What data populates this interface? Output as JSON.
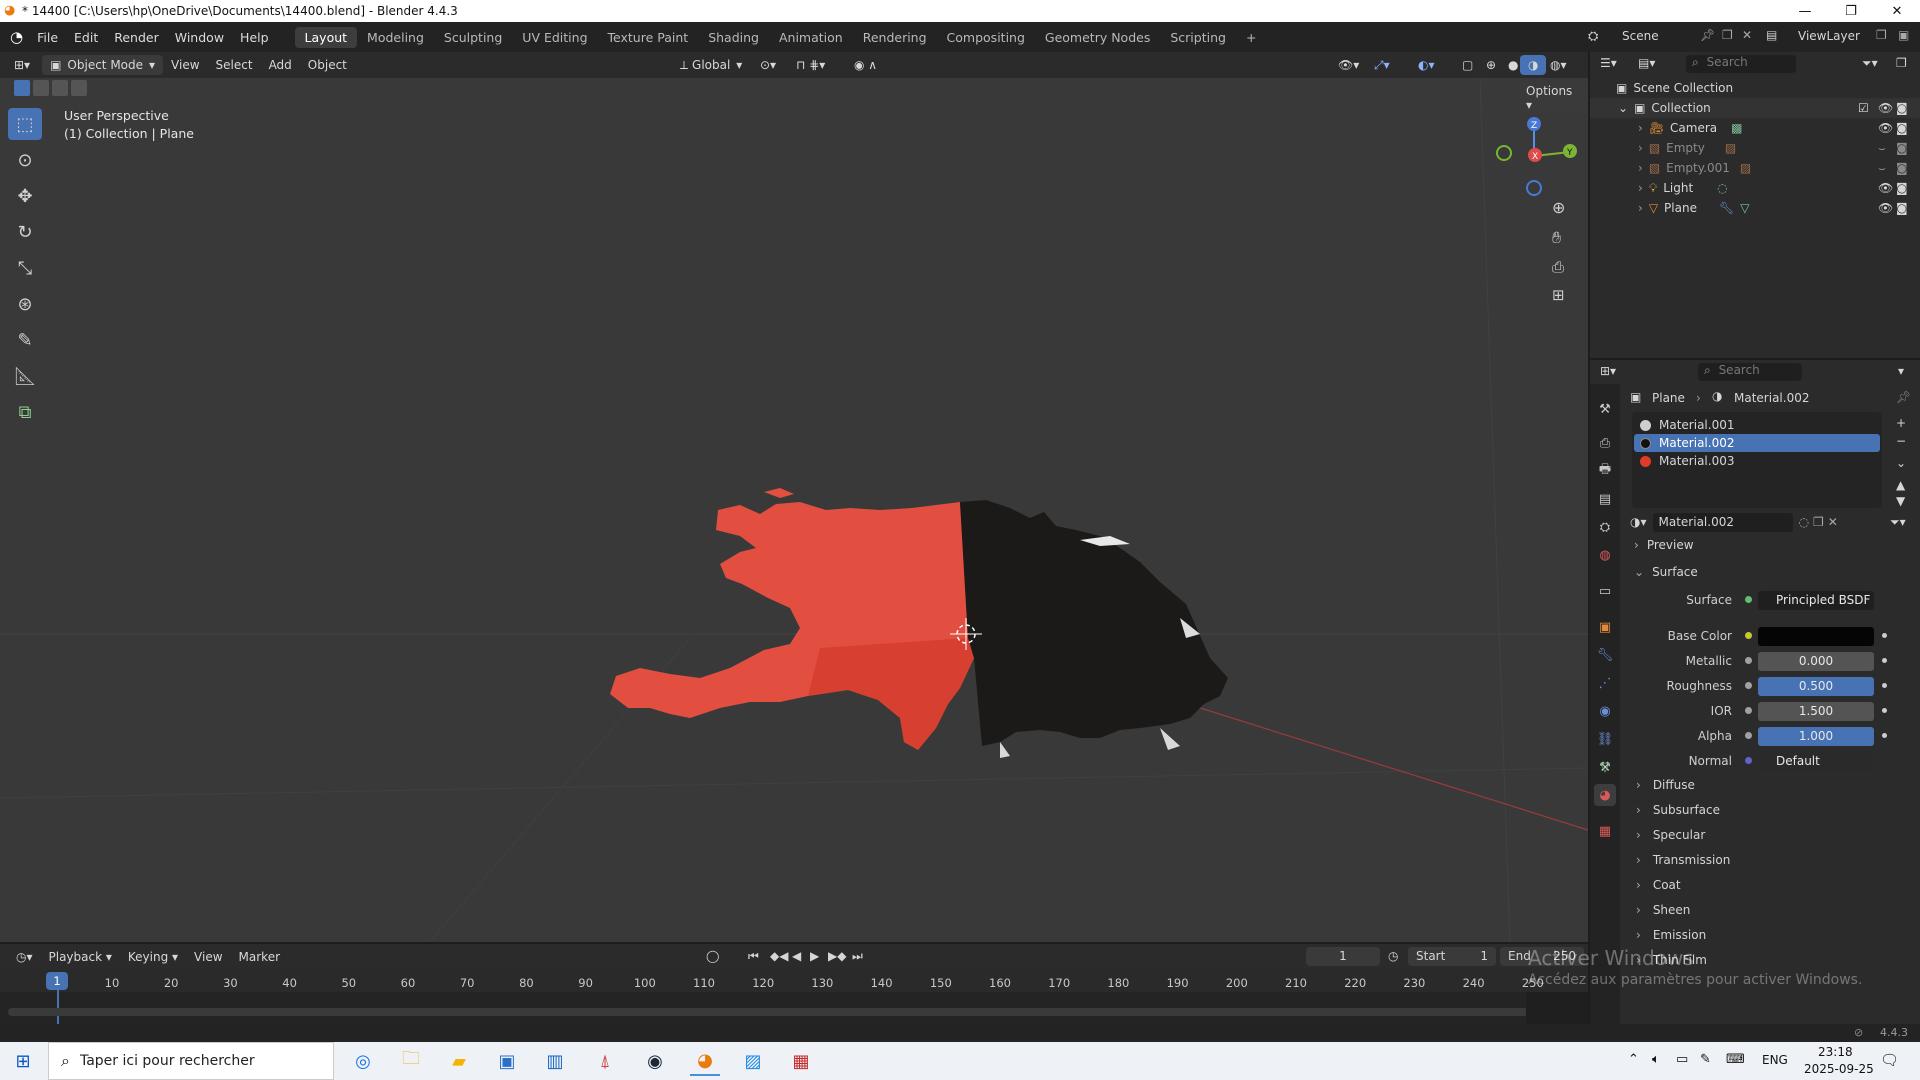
{
  "window": {
    "title": "* 14400 [C:\\Users\\hp\\OneDrive\\Documents\\14400.blend] - Blender 4.4.3",
    "minimize": "—",
    "maximize": "❐",
    "close": "✕"
  },
  "menu": [
    "File",
    "Edit",
    "Render",
    "Window",
    "Help"
  ],
  "workspaces": [
    "Layout",
    "Modeling",
    "Sculpting",
    "UV Editing",
    "Texture Paint",
    "Shading",
    "Animation",
    "Rendering",
    "Compositing",
    "Geometry Nodes",
    "Scripting"
  ],
  "scene": {
    "label": "Scene",
    "view_layer": "ViewLayer"
  },
  "viewport_header": {
    "mode": "Object Mode",
    "menus": [
      "View",
      "Select",
      "Add",
      "Object"
    ],
    "orientation": "Global",
    "options": "Options"
  },
  "viewport": {
    "perspective": "User Perspective",
    "collection_info": "(1) Collection | Plane",
    "gizmo": {
      "z": "Z",
      "x": "X",
      "y": "Y"
    }
  },
  "outliner": {
    "search_placeholder": "Search",
    "scene_collection": "Scene Collection",
    "collection": "Collection",
    "items": [
      {
        "name": "Camera"
      },
      {
        "name": "Empty"
      },
      {
        "name": "Empty.001"
      },
      {
        "name": "Light"
      },
      {
        "name": "Plane"
      }
    ]
  },
  "properties": {
    "search_placeholder": "Search",
    "breadcrumb_object": "Plane",
    "breadcrumb_material": "Material.002",
    "slots": [
      {
        "name": "Material.001",
        "color": "#cfcfcf"
      },
      {
        "name": "Material.002",
        "color": "#111111"
      },
      {
        "name": "Material.003",
        "color": "#e03a2a"
      }
    ],
    "material_name": "Material.002",
    "panels": {
      "preview": "Preview",
      "surface": "Surface"
    },
    "surface": {
      "surface_label": "Surface",
      "surface_value": "Principled BSDF",
      "base_color_label": "Base Color",
      "metallic_label": "Metallic",
      "metallic": "0.000",
      "roughness_label": "Roughness",
      "roughness": "0.500",
      "ior_label": "IOR",
      "ior": "1.500",
      "alpha_label": "Alpha",
      "alpha": "1.000",
      "normal_label": "Normal",
      "normal": "Default"
    },
    "subpanels": [
      "Diffuse",
      "Subsurface",
      "Specular",
      "Transmission",
      "Coat",
      "Sheen",
      "Emission",
      "Thin Film"
    ]
  },
  "timeline": {
    "menus": [
      "Playback",
      "Keying",
      "View",
      "Marker"
    ],
    "current_frame": "1",
    "start_label": "Start",
    "start": "1",
    "end_label": "End",
    "end": "250",
    "ticks": [
      "10",
      "20",
      "30",
      "40",
      "50",
      "60",
      "70",
      "80",
      "90",
      "100",
      "110",
      "120",
      "130",
      "140",
      "150",
      "160",
      "170",
      "180",
      "190",
      "200",
      "210",
      "220",
      "230",
      "240",
      "250"
    ],
    "playhead": "1"
  },
  "watermark": {
    "line1": "Activer Windows",
    "line2": "Accédez aux paramètres pour activer Windows."
  },
  "statusbar": {
    "version": "4.4.3"
  },
  "taskbar": {
    "search_placeholder": "Taper ici pour rechercher",
    "lang": "ENG",
    "time": "23:18",
    "date": "2025-09-25"
  }
}
